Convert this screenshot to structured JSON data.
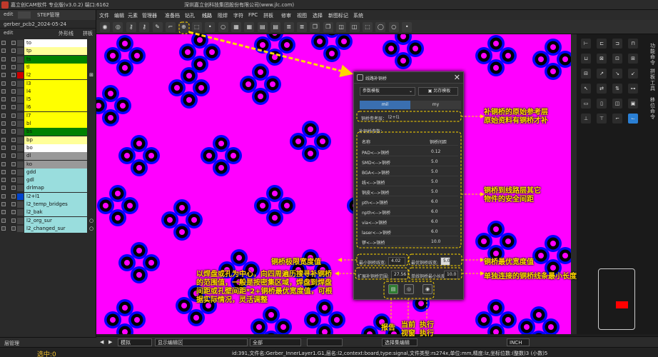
{
  "titlebar": {
    "title": "嘉立创CAM软件 专业版(v3.0.2) 端口:6162",
    "company": "深圳嘉立创科技集团股份有限公司(www.jlc.com)"
  },
  "left_panel": {
    "tabs": [
      "edit",
      "STEP管理"
    ],
    "job_name": "gerber_pcb2_2024-05-24",
    "header": {
      "step": "edit",
      "col1": "外形线",
      "col2": "拼板"
    },
    "layers": [
      {
        "name": "to",
        "color": "#ffffff",
        "mark": ""
      },
      {
        "name": "tp",
        "color": "#ffff99",
        "mark": ""
      },
      {
        "name": "ts",
        "color": "#008000",
        "mark": ""
      },
      {
        "name": "tl",
        "color": "#ffff00",
        "mark": ""
      },
      {
        "name": "l2",
        "color": "#ffff00",
        "mark": "⊞"
      },
      {
        "name": "l3",
        "color": "#ffff00",
        "mark": ""
      },
      {
        "name": "l4",
        "color": "#ffff00",
        "mark": ""
      },
      {
        "name": "l5",
        "color": "#ffff00",
        "mark": ""
      },
      {
        "name": "l6",
        "color": "#ffff00",
        "mark": ""
      },
      {
        "name": "l7",
        "color": "#ffff00",
        "mark": ""
      },
      {
        "name": "bl",
        "color": "#ffff00",
        "mark": ""
      },
      {
        "name": "bs",
        "color": "#008000",
        "mark": ""
      },
      {
        "name": "bp",
        "color": "#ffff99",
        "mark": ""
      },
      {
        "name": "bo",
        "color": "#ffffff",
        "mark": ""
      },
      {
        "name": "dl",
        "color": "#999999",
        "mark": ""
      },
      {
        "name": "ko",
        "color": "#999999",
        "mark": ""
      },
      {
        "name": "gdd",
        "color": "#99dddd",
        "mark": ""
      },
      {
        "name": "gdl",
        "color": "#99dddd",
        "mark": ""
      },
      {
        "name": "drlmap",
        "color": "#99dddd",
        "mark": ""
      },
      {
        "name": "l2+l1",
        "color": "#99dddd",
        "mark": ""
      },
      {
        "name": "l2_temp_bridges",
        "color": "#99dddd",
        "mark": ""
      },
      {
        "name": "l2_bak",
        "color": "#99dddd",
        "mark": ""
      },
      {
        "name": "l2_org_sur",
        "color": "#99dddd",
        "mark": "○"
      },
      {
        "name": "l2_changed_sur",
        "color": "#99dddd",
        "mark": "○"
      }
    ],
    "footer_label": "层管理"
  },
  "menu": [
    "文件",
    "编辑",
    "元素",
    "管理器",
    "准备档",
    "钻孔",
    "线路",
    "阻焊",
    "字符",
    "FPC",
    "拼板",
    "修审",
    "视图",
    "选择",
    "新图标记",
    "系统"
  ],
  "toolbar_icons": [
    "via-icon",
    "pad-icon",
    "key-icon",
    "key-icon",
    "pen-icon",
    "corner-icon",
    "target-icon",
    "select-icon",
    "dot-icon",
    "ring-icon",
    "grid-icon",
    "grid-icon",
    "table-icon",
    "table-icon",
    "layers-icon",
    "layers-icon",
    "copy-icon",
    "copy-icon",
    "split-icon",
    "split-icon",
    "select-icon",
    "circle-icon",
    "ring-icon",
    "dot-icon"
  ],
  "dialog": {
    "title": "线路补铜桥",
    "dropdown": "参数模板",
    "save_template": "另存模板",
    "unit_mil": "mil",
    "unit_my": "my",
    "ref_layer_label": "铜桥参考层：",
    "ref_layer_value": "l2+l1",
    "params_title": "补铜桥参数：",
    "col_name": "名称",
    "col_gap": "铜桥间距",
    "params": [
      {
        "name": "PAD<-->铜桥",
        "value": "0.12"
      },
      {
        "name": "SMD<-->铜桥",
        "value": "5.0"
      },
      {
        "name": "BGA<-->铜桥",
        "value": "5.0"
      },
      {
        "name": "线<-->铜桥",
        "value": "5.0"
      },
      {
        "name": "铜皮<-->铜桥",
        "value": "5.0"
      },
      {
        "name": "pth<-->铜桥",
        "value": "6.0"
      },
      {
        "name": "npth<-->铜桥",
        "value": "6.0"
      },
      {
        "name": "via<-->铜桥",
        "value": "6.0"
      },
      {
        "name": "laser<-->铜桥",
        "value": "6.0"
      },
      {
        "name": "锣<-->铜桥",
        "value": "10.0"
      }
    ],
    "min_width_label": "最小铜桥线宽:",
    "min_width_value": "4.02",
    "opt_width_label": "最优铜桥线宽:",
    "opt_width_value": "5.0",
    "search_range_label": "扩展补铜桥范围:",
    "search_range_value": "27.56",
    "min_length_label": "单线铜桥最小长度:",
    "min_length_value": "10.0"
  },
  "annotations": {
    "ref_layer": "补铜桥的原始参考层\n原始资料有铜桥才补",
    "safe_gap": "铜桥到线路层其它\n物件的安全间距",
    "min_width": "铜桥极限宽度值",
    "opt_width": "铜桥最优宽度值",
    "min_length": "单独连接的铜桥线条最小长度",
    "search_range": "以焊盘或孔为中心，向四周遍历搜寻补铜桥的范围值，一般是按密集区域，焊盘到焊盘间距或孔壁间距*2+铜桥最优宽度值，可根据实际情况，灵活调整",
    "report": "报告",
    "current_view": "当前\n视窗",
    "execute": "执行\n执行"
  },
  "bottom_bar": {
    "mode": "模拟",
    "func_button": "显示编辑区",
    "filter": "全部",
    "select_all": "选择集编辑",
    "unit": "INCH"
  },
  "status": {
    "selected": "选中:0",
    "info": "id:391,文件名:Gerber_InnerLayer1.G1,层名:l2,context:board,type:signal,文件类型:rs274x,单位:mm,精度:lz,坐标位数:(整数)3 (小数)5"
  },
  "right_panel": {
    "side_labels": [
      "功能命令",
      "拼板工具",
      "移位命令"
    ]
  },
  "colors": {
    "canvas": "#ff00ff",
    "pad_outer": "#0000ff",
    "pad_ring": "#000000",
    "pad_center": "#ff00ff",
    "annotation": "#ffd700",
    "accent": "#3a6fb0"
  }
}
